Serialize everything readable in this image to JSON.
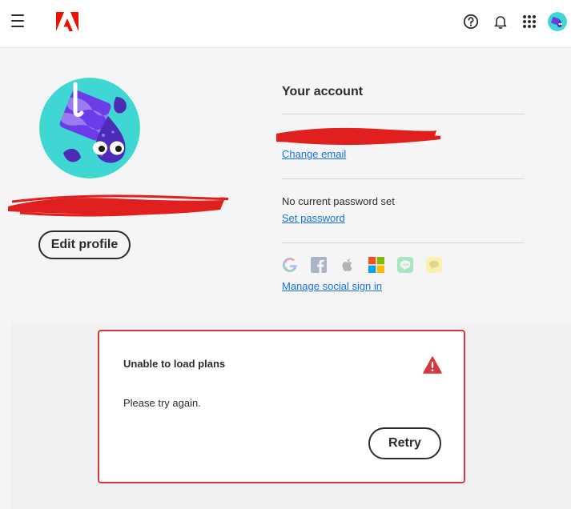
{
  "header": {
    "menu_icon": "hamburger-menu-icon",
    "logo_icon": "adobe-logo-icon",
    "help_icon": "help-circle-icon",
    "notifications_icon": "bell-icon",
    "apps_icon": "app-grid-icon",
    "avatar_icon": "user-avatar-icon"
  },
  "profile": {
    "edit_label": "Edit profile",
    "name_redacted": true
  },
  "account": {
    "title": "Your account",
    "email_redacted": true,
    "change_email_label": "Change email",
    "password_status": "No current password set",
    "set_password_label": "Set password",
    "social_icons": [
      "google-icon",
      "facebook-icon",
      "apple-icon",
      "microsoft-icon",
      "line-icon",
      "kakao-icon"
    ],
    "manage_social_label": "Manage social sign in"
  },
  "plans_error": {
    "title": "Unable to load plans",
    "message": "Please try again.",
    "retry_label": "Retry",
    "icon": "alert-triangle-icon"
  },
  "colors": {
    "accent_link": "#1473e6",
    "error_red": "#d7373f",
    "redaction": "#e01f1f",
    "avatar_bg": "#3fd6d3"
  }
}
